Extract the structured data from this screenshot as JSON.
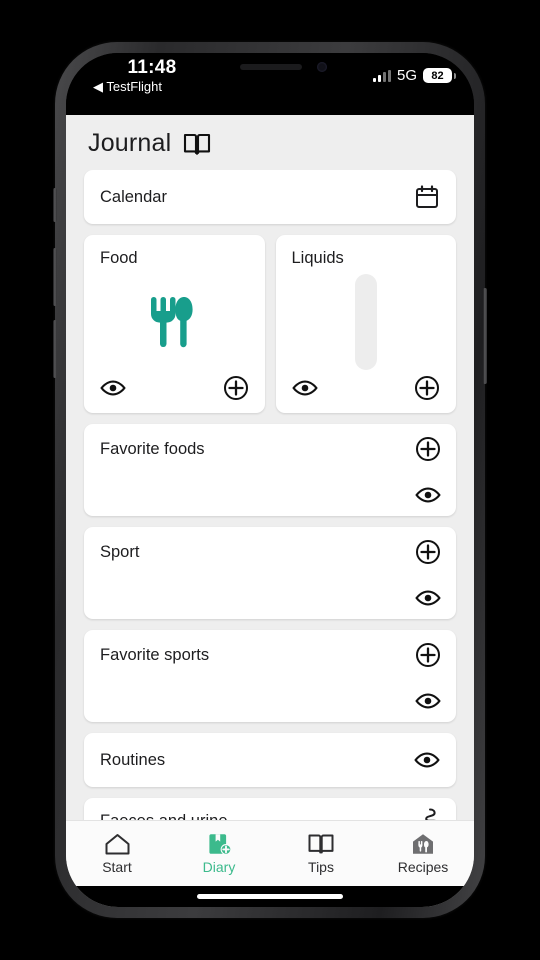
{
  "status_bar": {
    "time": "11:48",
    "return_app": "◀ TestFlight",
    "network": "5G",
    "battery": "82",
    "signal_icon": "signal-bars-icon",
    "battery_icon": "battery-icon"
  },
  "header": {
    "title": "Journal",
    "icon": "open-book-icon"
  },
  "cards": {
    "calendar": {
      "title": "Calendar",
      "icon": "calendar-icon"
    },
    "food": {
      "title": "Food",
      "graphic": "fork-knife-icon",
      "eye": "eye-icon",
      "plus": "plus-circle-icon"
    },
    "liquids": {
      "title": "Liquids",
      "graphic": "liquid-gauge-icon",
      "eye": "eye-icon",
      "plus": "plus-circle-icon"
    },
    "favorite_foods": {
      "title": "Favorite foods",
      "plus": "plus-circle-icon",
      "eye": "eye-icon"
    },
    "sport": {
      "title": "Sport",
      "plus": "plus-circle-icon",
      "eye": "eye-icon"
    },
    "favorite_sports": {
      "title": "Favorite sports",
      "plus": "plus-circle-icon",
      "eye": "eye-icon"
    },
    "routines": {
      "title": "Routines",
      "eye": "eye-icon"
    },
    "faeces_and_urine": {
      "title": "Faeces and urine",
      "icon": "stool-icon"
    }
  },
  "tab_bar": {
    "tabs": [
      {
        "label": "Start",
        "icon": "home-icon",
        "active": false
      },
      {
        "label": "Diary",
        "icon": "diary-add-icon",
        "active": true
      },
      {
        "label": "Tips",
        "icon": "open-book-icon",
        "active": false
      },
      {
        "label": "Recipes",
        "icon": "house-cutlery-icon",
        "active": false
      }
    ]
  },
  "colors": {
    "accent_green": "#3cba8c",
    "food_icon_teal": "#189e8c",
    "app_background": "#eeeeee",
    "card_background": "#ffffff",
    "text_primary": "#1d1d1f"
  }
}
